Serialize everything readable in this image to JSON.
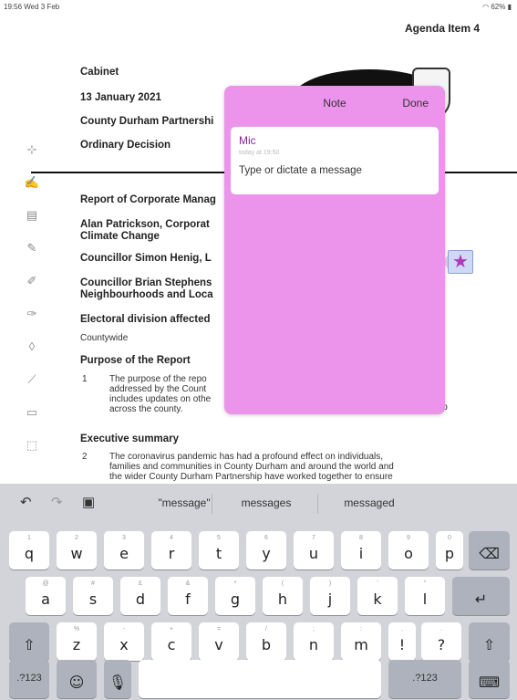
{
  "status": {
    "time": "19:56  Wed 3 Feb",
    "battery": "62%"
  },
  "document": {
    "agenda_item": "Agenda Item 4",
    "header": {
      "meeting": "Cabinet",
      "date": "13 January 2021",
      "title_partial": "County Durham Partnershi",
      "decision": "Ordinary Decision"
    },
    "report_of": "Report of Corporate Manag",
    "officer_line1": "Alan Patrickson, Corporat",
    "officer_line2": "Climate Change",
    "councillor1": "Councillor Simon Henig, L",
    "councillor2_line1": "Councillor Brian Stephens",
    "councillor2_line2": "Neighbourhoods and Loca",
    "electoral_heading": "Electoral division affected",
    "electoral_value": "Countywide",
    "purpose_heading": "Purpose of the Report",
    "purpose_num": "1",
    "purpose_lines": [
      "The purpose of the repo",
      "addressed by the Count",
      "includes updates on othe",
      "across the county."
    ],
    "purpose_tail": "ip",
    "exec_heading": "Executive summary",
    "exec_num": "2",
    "exec_lines": [
      "The coronavirus pandemic has had a profound effect on individuals,",
      "families and communities in County Durham and around the world and",
      "the wider County Durham Partnership have worked together to ensure"
    ]
  },
  "toolbar": {
    "tools": [
      "text-strike-icon",
      "signature-icon",
      "note-tool-icon",
      "pen-icon",
      "pen-plus-icon",
      "highlighter-icon",
      "eraser-icon",
      "line-icon",
      "image-icon",
      "selection-icon"
    ]
  },
  "note": {
    "title": "Note",
    "done": "Done",
    "author": "Mic",
    "timestamp": "today at 19:50",
    "placeholder": "Type or dictate a message"
  },
  "keyboard": {
    "suggestions": [
      "\"message\"",
      "messages",
      "messaged"
    ],
    "row1": [
      {
        "main": "q",
        "sub": "1"
      },
      {
        "main": "w",
        "sub": "2"
      },
      {
        "main": "e",
        "sub": "3"
      },
      {
        "main": "r",
        "sub": "4"
      },
      {
        "main": "t",
        "sub": "5"
      },
      {
        "main": "y",
        "sub": "6"
      },
      {
        "main": "u",
        "sub": "7"
      },
      {
        "main": "i",
        "sub": "8"
      },
      {
        "main": "o",
        "sub": "9"
      },
      {
        "main": "p",
        "sub": "0"
      }
    ],
    "row2": [
      {
        "main": "a",
        "sub": "@"
      },
      {
        "main": "s",
        "sub": "#"
      },
      {
        "main": "d",
        "sub": "£"
      },
      {
        "main": "f",
        "sub": "&"
      },
      {
        "main": "g",
        "sub": "*"
      },
      {
        "main": "h",
        "sub": "("
      },
      {
        "main": "j",
        "sub": ")"
      },
      {
        "main": "k",
        "sub": "'"
      },
      {
        "main": "l",
        "sub": "\""
      }
    ],
    "row3": [
      {
        "main": "z",
        "sub": "%"
      },
      {
        "main": "x",
        "sub": "-"
      },
      {
        "main": "c",
        "sub": "+"
      },
      {
        "main": "v",
        "sub": "="
      },
      {
        "main": "b",
        "sub": "/"
      },
      {
        "main": "n",
        "sub": ";"
      },
      {
        "main": "m",
        "sub": ":"
      },
      {
        "main": "!",
        "sub": ","
      },
      {
        "main": "?",
        "sub": "."
      }
    ],
    "numbers_left": ".?123",
    "numbers_right": ".?123",
    "delete_glyph": "⌫",
    "return_glyph": "↵",
    "shift_glyph": "⇧",
    "emoji_glyph": "☺",
    "mic_glyph": "🎙",
    "hide_glyph": "⌨"
  }
}
